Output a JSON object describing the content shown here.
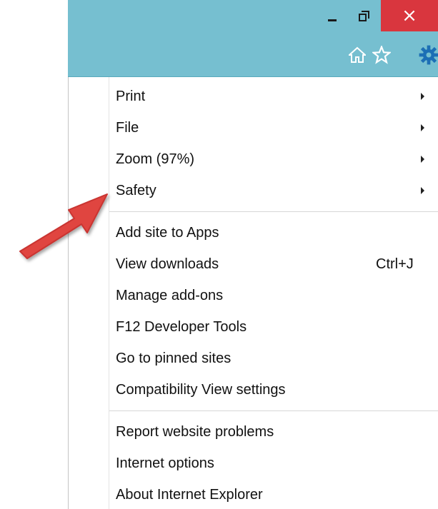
{
  "window_controls": {
    "minimize_icon": "minimize-icon",
    "maximize_icon": "restore-icon",
    "close_label": "×"
  },
  "toolbar": {
    "icons": [
      "home-icon",
      "star-icon",
      "gear-icon"
    ]
  },
  "menu": {
    "groups": [
      {
        "items": [
          {
            "label": "Print",
            "submenu": true
          },
          {
            "label": "File",
            "submenu": true
          },
          {
            "label": "Zoom (97%)",
            "submenu": true
          },
          {
            "label": "Safety",
            "submenu": true
          }
        ]
      },
      {
        "items": [
          {
            "label": "Add site to Apps"
          },
          {
            "label": "View downloads",
            "shortcut": "Ctrl+J"
          },
          {
            "label": "Manage add-ons"
          },
          {
            "label": "F12 Developer Tools"
          },
          {
            "label": "Go to pinned sites"
          },
          {
            "label": "Compatibility View settings"
          }
        ]
      },
      {
        "items": [
          {
            "label": "Report website problems"
          },
          {
            "label": "Internet options"
          },
          {
            "label": "About Internet Explorer"
          }
        ]
      }
    ]
  },
  "colors": {
    "titlebar": "#76bfd0",
    "close_button": "#d9363e",
    "annotation_arrow": "#e0443f",
    "gear": "#1c6fb5"
  }
}
